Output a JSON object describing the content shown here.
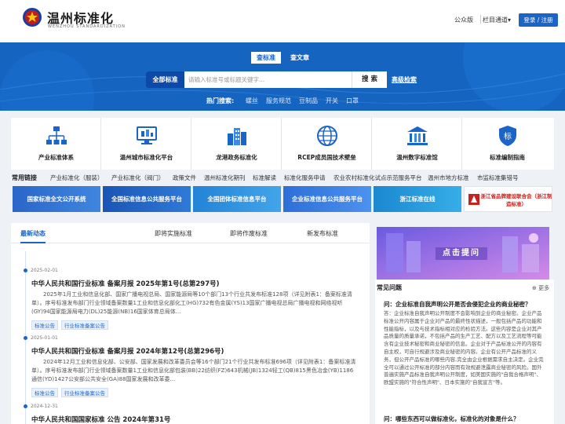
{
  "header": {
    "title": "温州标准化",
    "subtitle": "WENZHOU STANDARDIZATION",
    "public_account": "公众版",
    "column_nav": "栏目通道▾",
    "login": "登录 / 注册"
  },
  "search": {
    "tabs": [
      "查标准",
      "查文章"
    ],
    "category": "全部标准",
    "placeholder": "请输入标准号或标题关键字...",
    "button": "搜 索",
    "advanced": "高级检索",
    "hot_label": "热门搜索:",
    "hot_items": [
      "螺丝",
      "服务规范",
      "豆制品",
      "开关",
      "口罩"
    ]
  },
  "cards": [
    {
      "label": "产业标准体系",
      "icon": "org-chart-icon"
    },
    {
      "label": "温州城市标准化平台",
      "icon": "monitor-icon"
    },
    {
      "label": "龙港政务标准化",
      "icon": "city-buildings-icon"
    },
    {
      "label": "RCEP成员国技术壁垒",
      "icon": "globe-icon"
    },
    {
      "label": "温州数字标准馆",
      "icon": "museum-icon"
    },
    {
      "label": "标准编制指南",
      "icon": "shield-badge-icon"
    }
  ],
  "links": {
    "title": "常用链接",
    "items": [
      "产业标准化（服装）",
      "产业标准化（阀门）",
      "政策文件",
      "温州标准化期刊",
      "标准解读",
      "标准化服务申请",
      "农业农村标准化试点示范服务平台",
      "温州市地方标准",
      "市监标准集错号"
    ]
  },
  "platforms": [
    {
      "label": "国家标准全文公开系统",
      "color": "#2f6fd0"
    },
    {
      "label": "全国标准信息公共服务平台",
      "color": "#1f5fbf"
    },
    {
      "label": "全国团体标准信息平台",
      "color": "#2a8ad8"
    },
    {
      "label": "企业标准信息公共服务平台",
      "color": "#3a7ee0"
    },
    {
      "label": "浙江标准在线",
      "color": "#1c8fd6"
    },
    {
      "label": "浙江省品牌建设联合会（浙江制造标准）",
      "color": "#ffffff"
    }
  ],
  "news": {
    "tabs": [
      "最新动态",
      "即将实施标准",
      "即将作废标准",
      "新发布标准"
    ],
    "items": [
      {
        "date": "2025-02-01",
        "title": "中华人民共和国行业标准 备案月报 2025年第1号(总第297号)",
        "desc": "2025年1月工业和信息化部、国家广播电视总局、国家能源局等10个部门13个行业共发布标准128项（详见附表1：备案标准清单）。序号标准发布部门行业领域备案数量1工业和信息化部化工(HG)732有色金属(YS)13国家广播电视总局广播电视和网络视听(GY)94国家能源局电力(DL)25能源(NB)16国家体育总局体...",
        "tags": [
          "标准公告",
          "行业标准备案公告"
        ]
      },
      {
        "date": "2025-01-01",
        "title": "中华人民共和国行业标准 备案月报 2024年第12号(总第296号)",
        "desc": "2024年12月工业和信息化部、公安部、国家发展和改革委员会等16个部门21个行业共发布标准696项（详见附表1：备案标准清单）。序号标准发布部门行业领域备案数量1工业和信息化部包装(BB)22纺织(FZ)643机械(JB)1324轻工(QB)815黑色冶金(YB)1186通信(YD)1427公安部公共安全(GA)88国家发展和改革委...",
        "tags": [
          "标准公告",
          "行业标准备案公告"
        ]
      },
      {
        "date": "2024-12-31",
        "title": "中华人民共和国国家标准 公告 2024年第31号",
        "desc": "",
        "tags": []
      }
    ]
  },
  "ad": {
    "label": "点击提问"
  },
  "faq": {
    "title": "常见问题",
    "more": "更多",
    "items": [
      {
        "q": "问：企业标准自我声明公开是否会侵犯企业的商业秘密？",
        "a": "答：企业标准自我声明公开制度不会影响到企业的商业秘密。企业产品标准公开内容属于企业对产品的最终性状描述，一般包括产品的功能和性能指标，以及与技术指标相对应的检验方法。这些内容是企业对其产品质量的质量承诺，不包括产品的生产工艺、配方以及工艺流程等可能含有企业技术秘密和商业秘密的信息。企业对于产品标准公开的内容有自主权，可自行规避涉及商业秘密的内容。企业有公开产品标准的义务，但公开产品标准的哪些内容,完全由企业根据需求自主决定。企业完全可以通过公开标准的部分内容而有效规避泄露商业秘密的风险。国外普遍实施产品标准自我声明公开制度，如美国实施的\"自我合格声明\"、欧盟实施的\"符合性声明\"、日本实施的\"自我宣言\"等。"
      },
      {
        "q": "问：哪些东西可以做标准化，标准化的对象是什么？",
        "a": ""
      }
    ]
  }
}
